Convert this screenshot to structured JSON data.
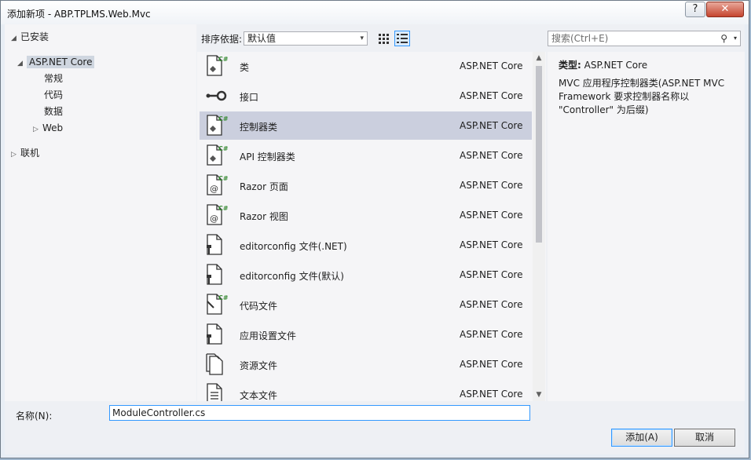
{
  "window": {
    "title": "添加新项 - ABP.TPLMS.Web.Mvc",
    "help_glyph": "?",
    "close_glyph": "✕"
  },
  "tree": {
    "installed": "已安装",
    "aspnet_core": "ASP.NET Core",
    "children": [
      "常规",
      "代码",
      "数据"
    ],
    "web": "Web",
    "online": "联机"
  },
  "toolbar": {
    "sort_label": "排序依据:",
    "sort_value": "默认值",
    "search_placeholder": "搜索(Ctrl+E)"
  },
  "templates": [
    {
      "name": "类",
      "category": "ASP.NET Core",
      "icon": "class-file-icon"
    },
    {
      "name": "接口",
      "category": "ASP.NET Core",
      "icon": "interface-icon"
    },
    {
      "name": "控制器类",
      "category": "ASP.NET Core",
      "icon": "controller-file-icon",
      "selected": true
    },
    {
      "name": "API 控制器类",
      "category": "ASP.NET Core",
      "icon": "api-controller-file-icon"
    },
    {
      "name": "Razor 页面",
      "category": "ASP.NET Core",
      "icon": "razor-page-icon"
    },
    {
      "name": "Razor 视图",
      "category": "ASP.NET Core",
      "icon": "razor-view-icon"
    },
    {
      "name": "editorconfig 文件(.NET)",
      "category": "ASP.NET Core",
      "icon": "config-file-icon"
    },
    {
      "name": "editorconfig 文件(默认)",
      "category": "ASP.NET Core",
      "icon": "config-file-icon"
    },
    {
      "name": "代码文件",
      "category": "ASP.NET Core",
      "icon": "code-file-icon"
    },
    {
      "name": "应用设置文件",
      "category": "ASP.NET Core",
      "icon": "settings-file-icon"
    },
    {
      "name": "资源文件",
      "category": "ASP.NET Core",
      "icon": "resource-file-icon"
    },
    {
      "name": "文本文件",
      "category": "ASP.NET Core",
      "icon": "text-file-icon"
    }
  ],
  "details": {
    "type_label": "类型:",
    "type_value": "ASP.NET Core",
    "description": "MVC 应用程序控制器类(ASP.NET MVC Framework 要求控制器名称以 \"Controller\" 为后缀)"
  },
  "footer": {
    "name_label": "名称(N):",
    "name_value": "ModuleController.cs",
    "add_label": "添加(A)",
    "cancel_label": "取消"
  },
  "colors": {
    "selection": "#cbcfde",
    "accent": "#3399ff",
    "csharp_green": "#388a34"
  }
}
